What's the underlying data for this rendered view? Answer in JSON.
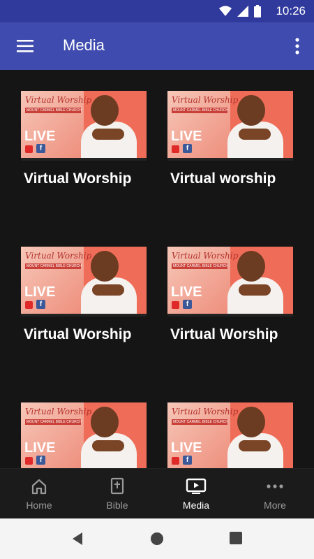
{
  "status": {
    "time": "10:26"
  },
  "appbar": {
    "title": "Media"
  },
  "media": [
    {
      "title": "Virtual Worship",
      "thumb": {
        "script": "Virtual Worship",
        "church": "MOUNT CARMEL BIBLE CHURCH",
        "live": "LIVE",
        "fb": "f"
      }
    },
    {
      "title": "Virtual worship",
      "thumb": {
        "script": "Virtual Worship",
        "church": "MOUNT CARMEL BIBLE CHURCH",
        "live": "LIVE",
        "fb": "f"
      }
    },
    {
      "title": "Virtual Worship",
      "thumb": {
        "script": "Virtual Worship",
        "church": "MOUNT CARMEL BIBLE CHURCH",
        "live": "LIVE",
        "fb": "f"
      }
    },
    {
      "title": "Virtual Worship",
      "thumb": {
        "script": "Virtual Worship",
        "church": "MOUNT CARMEL BIBLE CHURCH",
        "live": "LIVE",
        "fb": "f"
      }
    },
    {
      "title": "",
      "thumb": {
        "script": "Virtual Worship",
        "church": "MOUNT CARMEL BIBLE CHURCH",
        "live": "LIVE",
        "fb": "f"
      }
    },
    {
      "title": "",
      "thumb": {
        "script": "Virtual Worship",
        "church": "MOUNT CARMEL BIBLE CHURCH",
        "live": "LIVE",
        "fb": "f"
      }
    }
  ],
  "nav": [
    {
      "label": "Home",
      "icon": "home-icon"
    },
    {
      "label": "Bible",
      "icon": "bible-icon"
    },
    {
      "label": "Media",
      "icon": "media-icon",
      "active": true
    },
    {
      "label": "More",
      "icon": "more-icon"
    }
  ],
  "colors": {
    "primary": "#3f4bae",
    "statusbar": "#303a9c",
    "background": "#151515",
    "accent_thumb": "#ef6d58"
  }
}
